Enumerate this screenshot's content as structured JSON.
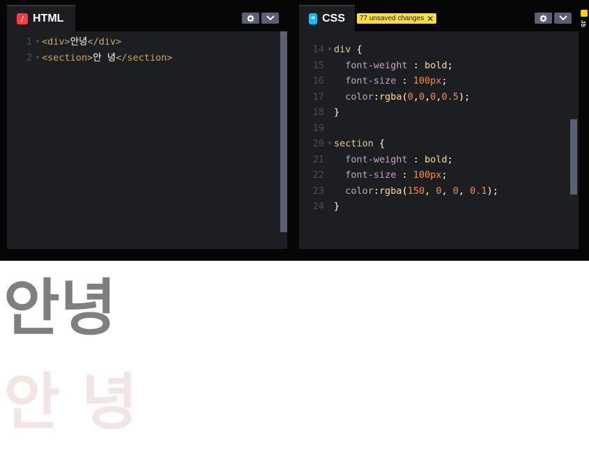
{
  "html_panel": {
    "tab_label": "HTML",
    "icon": "html-icon",
    "lines": [
      {
        "num": "1",
        "open": "<div>",
        "text": "안녕",
        "close": "</div>"
      },
      {
        "num": "2",
        "open": "<section>",
        "text": "안 녕",
        "close": "</section>"
      }
    ]
  },
  "css_panel": {
    "tab_label": "CSS",
    "icon": "css-icon",
    "unsaved_badge": "77 unsaved changes",
    "lines": [
      {
        "num": "14",
        "parts": [
          [
            "sel",
            "div"
          ],
          [
            "plain",
            " {"
          ]
        ]
      },
      {
        "num": "15",
        "parts": [
          [
            "prop",
            "  font-weight"
          ],
          [
            "plain",
            " : "
          ],
          [
            "kw",
            "bold"
          ],
          [
            "plain",
            ";"
          ]
        ]
      },
      {
        "num": "16",
        "parts": [
          [
            "prop",
            "  font-size"
          ],
          [
            "plain",
            " : "
          ],
          [
            "num",
            "100px"
          ],
          [
            "plain",
            ";"
          ]
        ]
      },
      {
        "num": "17",
        "parts": [
          [
            "prop",
            "  color"
          ],
          [
            "plain",
            ":"
          ],
          [
            "fn",
            "rgba"
          ],
          [
            "plain",
            "("
          ],
          [
            "num",
            "0"
          ],
          [
            "plain",
            ","
          ],
          [
            "num",
            "0"
          ],
          [
            "plain",
            ","
          ],
          [
            "num",
            "0"
          ],
          [
            "plain",
            ","
          ],
          [
            "num",
            "0.5"
          ],
          [
            "plain",
            ");"
          ]
        ]
      },
      {
        "num": "18",
        "parts": [
          [
            "plain",
            "}"
          ]
        ]
      },
      {
        "num": "19",
        "parts": []
      },
      {
        "num": "20",
        "parts": [
          [
            "sel",
            "section"
          ],
          [
            "plain",
            " {"
          ]
        ]
      },
      {
        "num": "21",
        "parts": [
          [
            "prop",
            "  font-weight"
          ],
          [
            "plain",
            " : "
          ],
          [
            "kw",
            "bold"
          ],
          [
            "plain",
            ";"
          ]
        ]
      },
      {
        "num": "22",
        "parts": [
          [
            "prop",
            "  font-size"
          ],
          [
            "plain",
            " : "
          ],
          [
            "num",
            "100px"
          ],
          [
            "plain",
            ";"
          ]
        ]
      },
      {
        "num": "23",
        "parts": [
          [
            "prop",
            "  color"
          ],
          [
            "plain",
            ":"
          ],
          [
            "fn",
            "rgba"
          ],
          [
            "plain",
            "("
          ],
          [
            "num",
            "150"
          ],
          [
            "plain",
            ", "
          ],
          [
            "num",
            "0"
          ],
          [
            "plain",
            ", "
          ],
          [
            "num",
            "0"
          ],
          [
            "plain",
            ", "
          ],
          [
            "num",
            "0.1"
          ],
          [
            "plain",
            ");"
          ]
        ]
      },
      {
        "num": "24",
        "parts": [
          [
            "plain",
            "}"
          ]
        ]
      }
    ]
  },
  "js_panel": {
    "label": "JS"
  },
  "output": {
    "div_text": "안녕",
    "section_text": "안 녕"
  },
  "colors": {
    "editor_bg": "#1d1e22",
    "chrome_bg": "#060606",
    "badge_bg": "#ffdd40",
    "button_bg": "#5a5f73"
  }
}
